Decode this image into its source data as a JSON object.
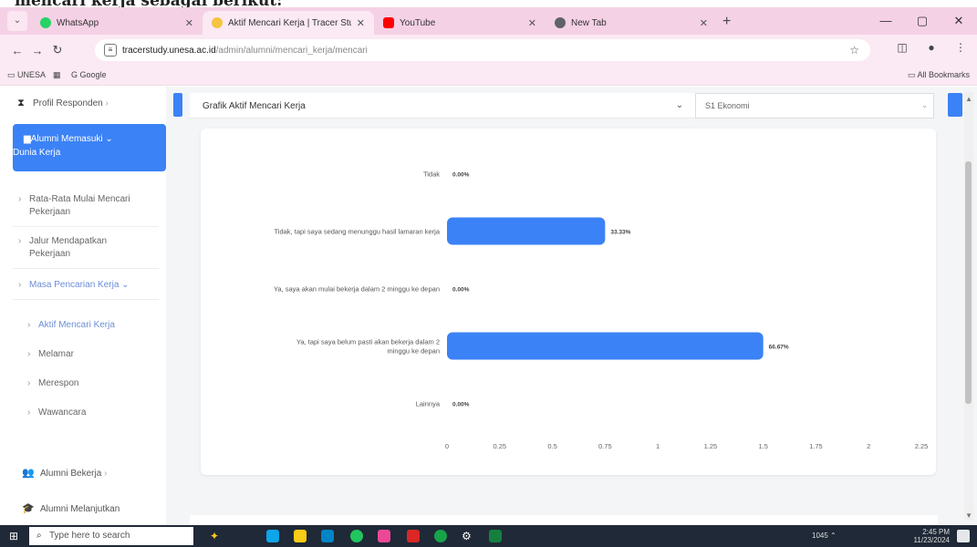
{
  "doc_strip": {
    "text": "mencari kerja sebagai berikut:"
  },
  "tabs": [
    {
      "title": "WhatsApp",
      "color": "#25d366",
      "active": false
    },
    {
      "title": "Aktif Mencari Kerja | Tracer Stu...",
      "color": "#f5c542",
      "active": true
    },
    {
      "title": "YouTube",
      "color": "#ff0000",
      "active": false
    },
    {
      "title": "New Tab",
      "color": "#5f6368",
      "active": false
    }
  ],
  "url": {
    "host": "tracerstudy.unesa.ac.id",
    "path": "/admin/alumni/mencari_kerja/mencari"
  },
  "bookmarks": {
    "left": [
      "UNESA",
      "Google"
    ],
    "right": "All Bookmarks"
  },
  "sidebar": {
    "top_item": "Profil Responden",
    "active_line1": "Alumni Memasuki",
    "active_line2": "Dunia Kerja",
    "subs": [
      "Rata-Rata Mulai Mencari",
      "Pekerjaan",
      "Jalur Mendapatkan",
      "Pekerjaan",
      "Masa Pencarian Kerja"
    ],
    "subsubs": [
      "Aktif Mencari Kerja",
      "Melamar",
      "Merespon",
      "Wawancara"
    ],
    "bottom_items": [
      "Alumni Bekerja",
      "Alumni Melanjutkan"
    ]
  },
  "main": {
    "card_title": "Grafik Aktif Mencari Kerja",
    "select_value": "S1 Ekonomi"
  },
  "chart_data": {
    "type": "bar",
    "orientation": "horizontal",
    "categories": [
      "Tidak",
      "Tidak, tapi saya sedang menunggu hasil lamaran kerja",
      "Ya, saya akan mulai bekerja dalam 2 minggu ke depan",
      "Ya, tapi saya belum pasti akan bekerja dalam 2 minggu ke depan",
      "Lainnya"
    ],
    "values": [
      0,
      0.75,
      0,
      1.5,
      0
    ],
    "data_labels": [
      "0.00%",
      "33.33%",
      "0.00%",
      "66.67%",
      "0.00%"
    ],
    "xlim": [
      0,
      2.25
    ],
    "xticks": [
      "0",
      "0.25",
      "0.5",
      "0.75",
      "1",
      "1.25",
      "1.5",
      "1.75",
      "2",
      "2.25"
    ],
    "bar_color": "#3b82f6"
  },
  "taskbar": {
    "search_placeholder": "Type here to search",
    "time": "2:45 PM",
    "date": "11/23/2024",
    "weather": "1045"
  }
}
